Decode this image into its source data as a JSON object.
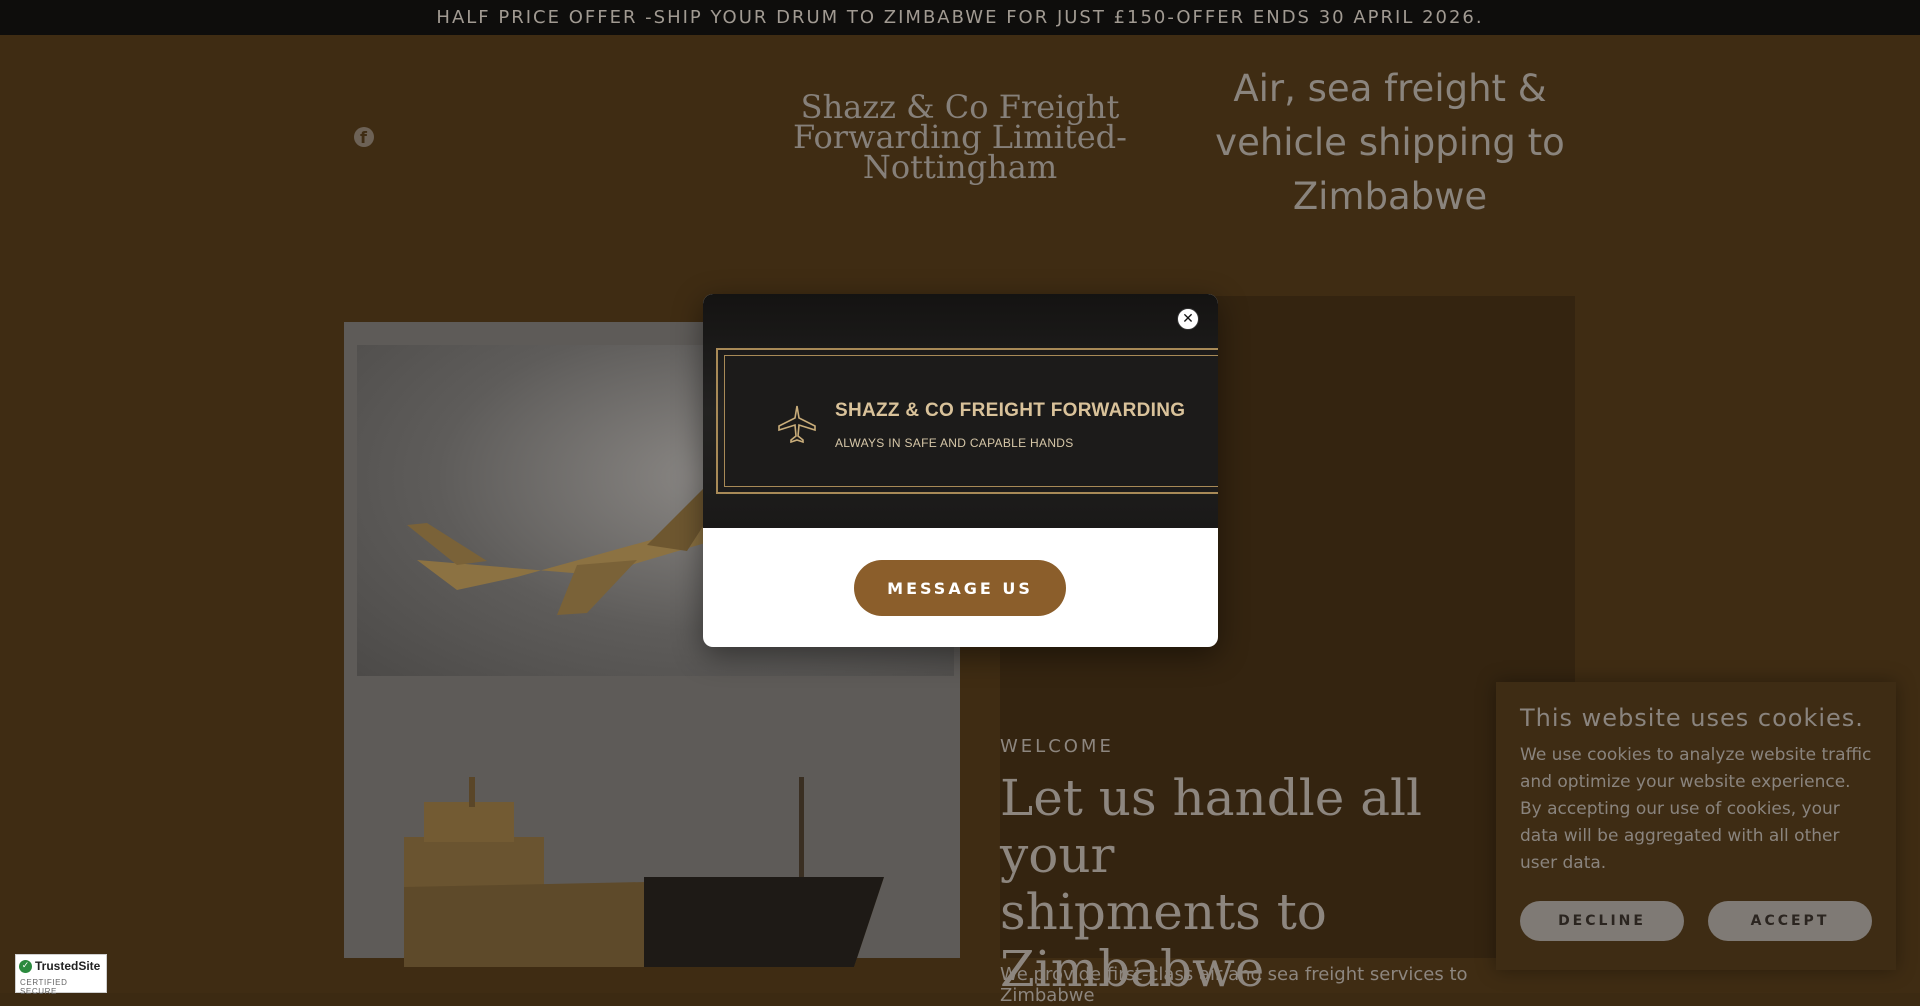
{
  "announcement": "HALF PRICE OFFER -SHIP YOUR DRUM TO ZIMBABWE FOR JUST £150-OFFER ENDS 30 APRIL 2026.",
  "header": {
    "social_icon": "facebook-icon",
    "brand_lines": [
      "Shazz & Co Freight",
      "Forwarding Limited-",
      "Nottingham"
    ],
    "tagline_lines": [
      "Air, sea freight &",
      "vehicle shipping to",
      "Zimbabwe"
    ]
  },
  "welcome": {
    "kicker": "WELCOME",
    "title_lines": [
      "Let us handle all your",
      "shipments to",
      "Zimbabwe"
    ],
    "body": "We provide first-class air and sea freight services to Zimbabwe"
  },
  "popup": {
    "close_icon": "close-icon",
    "logo_icon": "airplane-icon",
    "banner_title": "SHAZZ & CO FREIGHT FORWARDING",
    "banner_subtitle": "ALWAYS IN SAFE AND CAPABLE HANDS",
    "cta_label": "MESSAGE US"
  },
  "cookies": {
    "title": "This website uses cookies.",
    "body_lines": [
      "We use cookies to analyze website traffic",
      "and optimize your website experience.",
      "By accepting our use of cookies, your",
      "data will be aggregated with all other",
      "user data."
    ],
    "decline_label": "DECLINE",
    "accept_label": "ACCEPT"
  },
  "trusted_site": {
    "name": "TrustedSite",
    "subtitle": "CERTIFIED SECURE"
  },
  "colors": {
    "page_background": "#3f2c13",
    "cta_brown": "#8b5e2b",
    "banner_gold": "#d9c29a"
  }
}
